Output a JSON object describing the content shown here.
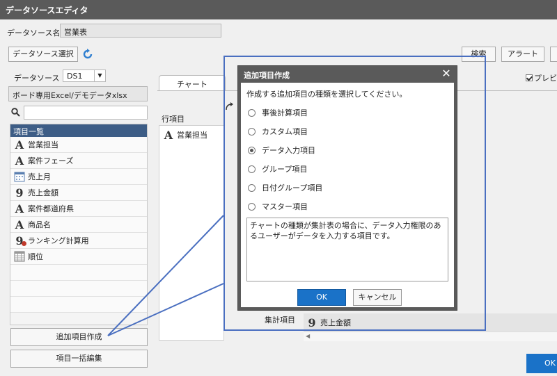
{
  "window": {
    "title": "データソースエディタ"
  },
  "datasource": {
    "name_label": "データソース名",
    "name_value": "営業表",
    "select_button": "データソース選択",
    "ds_label": "データソース",
    "ds_value": "DS1",
    "file_value": "ボード専用Excel/デモデータxlsx"
  },
  "toolbar": {
    "search_button": "検索",
    "alert_button": "アラート"
  },
  "preview": {
    "label": "プレビュ",
    "checked": true
  },
  "items": {
    "header": "項目一覧",
    "list": [
      {
        "label": "営業担当",
        "icon": "text-type-icon"
      },
      {
        "label": "案件フェーズ",
        "icon": "text-type-icon"
      },
      {
        "label": "売上月",
        "icon": "calendar-icon"
      },
      {
        "label": "売上金額",
        "icon": "number-type-icon"
      },
      {
        "label": "案件都道府県",
        "icon": "text-type-icon"
      },
      {
        "label": "商品名",
        "icon": "text-type-icon"
      },
      {
        "label": "ランキング計算用",
        "icon": "calculated-number-icon"
      },
      {
        "label": "順位",
        "icon": "table-grid-icon"
      }
    ],
    "add_button": "追加項目作成",
    "bulk_edit_button": "項目一括編集"
  },
  "chart_tab": {
    "label": "チャート"
  },
  "rows": {
    "label": "行項目",
    "chip": "営業担当"
  },
  "aggregate": {
    "label": "集計項目",
    "chip": "売上金額"
  },
  "footer": {
    "ok_button": "OK"
  },
  "dialog": {
    "title": "追加項目作成",
    "description": "作成する追加項目の種類を選択してください。",
    "options": [
      {
        "label": "事後計算項目",
        "checked": false
      },
      {
        "label": "カスタム項目",
        "checked": false
      },
      {
        "label": "データ入力項目",
        "checked": true
      },
      {
        "label": "グループ項目",
        "checked": false
      },
      {
        "label": "日付グループ項目",
        "checked": false
      },
      {
        "label": "マスター項目",
        "checked": false
      }
    ],
    "explanation": "チャートの種類が集計表の場合に、データ入力権限のあるユーザーがデータを入力する項目です。",
    "ok_button": "OK",
    "cancel_button": "キャンセル"
  },
  "colors": {
    "accent": "#1a72c8",
    "callout": "#4a6fc0",
    "list_header": "#3d5d86",
    "titlebar": "#5a5a5a"
  }
}
